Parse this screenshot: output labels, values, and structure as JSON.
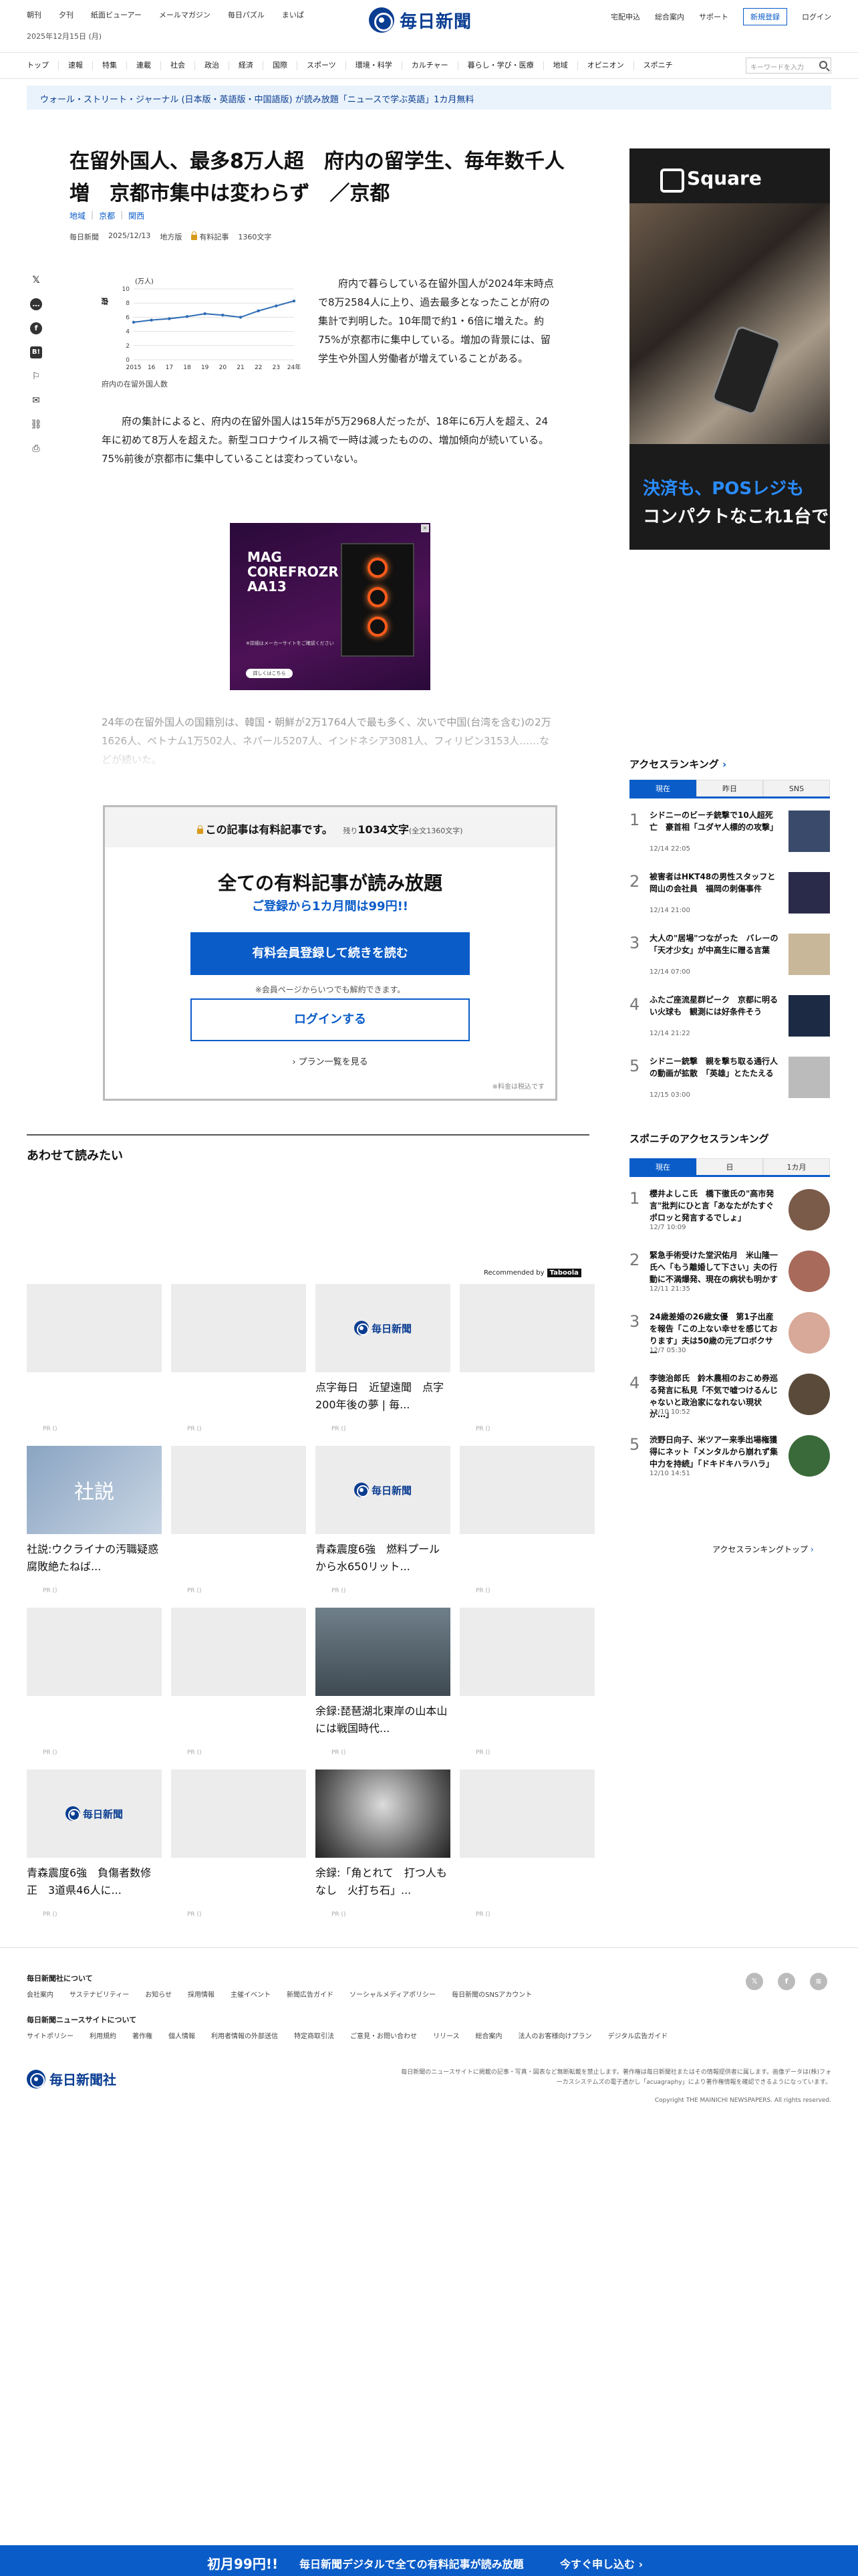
{
  "header": {
    "left_links": [
      "朝刊",
      "夕刊",
      "紙面ビューアー",
      "メールマガジン",
      "毎日パズル",
      "まいぱ"
    ],
    "date": "2025年12月15日 (月)",
    "logo_text": "毎日新聞",
    "right_links": [
      "宅配申込",
      "総合案内",
      "サポート"
    ],
    "signup_label": "新規登録",
    "login_label": "ログイン"
  },
  "nav": {
    "items": [
      "トップ",
      "速報",
      "特集",
      "連載",
      "社会",
      "政治",
      "経済",
      "国際",
      "スポーツ",
      "環境・科学",
      "カルチャー",
      "暮らし・学び・医療",
      "地域",
      "オピニオン",
      "スポニチ"
    ],
    "search_placeholder": "キーワードを入力"
  },
  "promo": "ウォール・ストリート・ジャーナル (日本版・英語版・中国語版) が読み放題「ニュースで学ぶ英語」1カ月無料",
  "article": {
    "headline": "在留外国人、最多8万人超　府内の留学生、毎年数千人増　京都市集中は変わらず　／京都",
    "tags": [
      "地域",
      "京都",
      "関西"
    ],
    "meta": {
      "source": "毎日新聞",
      "date": "2025/12/13",
      "edition": "地方版",
      "paid_label": "有料記事",
      "char_count": "1360文字"
    },
    "para1": "府内で暮らしている在留外国人が2024年末時点で8万2584人に上り、過去最多となったことが府の集計で判明した。10年間で約1・6倍に増えた。約75%が京都市に集中している。増加の背景には、留学生や外国人労働者が増えていることがある。",
    "para2": "府の集計によると、府内の在留外国人は15年が5万2968人だったが、18年に6万人を超え、24年に初めて8万人を超えた。新型コロナウイルス禍で一時は減ったものの、増加傾向が続いている。75%前後が京都市に集中していることは変わっていない。",
    "faded": "24年の在留外国人の国籍別は、韓国・朝鮮が2万1764人で最も多く、次いで中国(台湾を含む)の2万1626人、ベトナム1万502人、ネパール5207人、インドネシア3081人、フィリピン3153人……などが続いた。",
    "chart_caption": "府内の在留外国人数"
  },
  "chart_data": {
    "type": "line",
    "title": "府内の在留外国人数",
    "ylabel": "(万人)",
    "x": [
      "2015",
      "16",
      "17",
      "18",
      "19",
      "20",
      "21",
      "22",
      "23",
      "24年"
    ],
    "values": [
      5.3,
      5.6,
      5.8,
      6.1,
      6.5,
      6.3,
      6.0,
      6.9,
      7.6,
      8.3
    ],
    "yticks": [
      "10",
      "8",
      "6",
      "4",
      "2",
      "0"
    ],
    "ylim": [
      0,
      10
    ],
    "grid": true,
    "color": "#2f6db5"
  },
  "ad_mid": {
    "title": "MAG COREFROZR AA13",
    "note": "※詳細はメーカーサイトをご確認ください",
    "button": "詳しくはこちら"
  },
  "paywall": {
    "head": "この記事は有料記事です。",
    "remaining_prefix": "残り",
    "remaining": "1034文字",
    "remaining_suffix": "(全文1360文字)",
    "title": "全ての有料記事が読み放題",
    "subtitle": "ご登録から1カ月間は99円!!",
    "primary_button": "有料会員登録して続きを読む",
    "note": "※会員ページからいつでも解約できます。",
    "login_button": "ログインする",
    "plans": "プラン一覧を見る",
    "tax": "※料金は税込です"
  },
  "ad_right": {
    "brand": "Square",
    "line1": "決済も、POSレジも",
    "line2": "コンパクトなこれ1台で"
  },
  "ranking": {
    "title": "アクセスランキング",
    "tabs": [
      "現在",
      "昨日",
      "SNS"
    ],
    "items": [
      {
        "num": "1",
        "title": "シドニーのビーチ銃撃で10人超死亡　豪首相「ユダヤ人標的の攻撃」",
        "time": "12/14 22:05"
      },
      {
        "num": "2",
        "title": "被害者はHKT48の男性スタッフと岡山の会社員　福岡の刺傷事件",
        "time": "12/14 21:00"
      },
      {
        "num": "3",
        "title": "大人の\"居場\"つながった　バレーの「天才少女」が中高生に贈る言葉",
        "time": "12/14 07:00"
      },
      {
        "num": "4",
        "title": "ふたご座流星群ピーク　京都に明るい火球も　観測には好条件そう",
        "time": "12/14 21:22"
      },
      {
        "num": "5",
        "title": "シドニー銃撃　親を撃ち取る通行人の動画が拡散　「英雄」とたたえる",
        "time": "12/15 03:00"
      }
    ]
  },
  "sponichi": {
    "title": "スポニチのアクセスランキング",
    "tabs": [
      "現在",
      "日",
      "1カ月"
    ],
    "items": [
      {
        "num": "1",
        "title": "櫻井よしこ氏　橋下徹氏の\"高市発言\"批判にひと言「あなたがたすぐポロッと発言するでしょ」",
        "time": "12/7 10:09"
      },
      {
        "num": "2",
        "title": "緊急手術受けた堂沢佑月　米山隆一氏へ「もう離婚して下さい」夫の行動に不満爆発、現在の病状も明かす",
        "time": "12/11 21:35"
      },
      {
        "num": "3",
        "title": "24歳差婚の26歳女優　第1子出産を報告「この上ない幸せを感じております」夫は50歳の元プロボクサー",
        "time": "12/7 05:30"
      },
      {
        "num": "4",
        "title": "李徳治郎氏　鈴木農相のおこめ券巡る発言に私見「不気で嘘つけるんじゃないと政治家になれない現状が…」",
        "time": "12/10 10:52"
      },
      {
        "num": "5",
        "title": "渋野日向子、米ツアー来季出場権獲得にネット「メンタルから崩れず集中力を持続」「ドキドキハラハラ」",
        "time": "12/10 14:51"
      }
    ],
    "more": "アクセスランキングトップ"
  },
  "related": {
    "title": "あわせて読みたい",
    "recommended_by": "Recommended by",
    "rec_brand": "Taboola",
    "pr": "PR ()",
    "cards": [
      {
        "title": ""
      },
      {
        "title": ""
      },
      {
        "title": "点字毎日　近望遠聞　点字200年後の夢 | 毎..."
      },
      {
        "title": ""
      },
      {
        "title": "社説:ウクライナの汚職疑惑　腐敗絶たねば..."
      },
      {
        "title": ""
      },
      {
        "title": "青森震度6強　燃料プールから水650リット..."
      },
      {
        "title": ""
      },
      {
        "title": ""
      },
      {
        "title": ""
      },
      {
        "title": "余録:琵琶湖北東岸の山本山には戦国時代..."
      },
      {
        "title": ""
      },
      {
        "title": "青森震度6強　負傷者数修正　3道県46人に..."
      },
      {
        "title": ""
      },
      {
        "title": "余録:「角とれて　打つ人もなし　火打ち石」..."
      },
      {
        "title": ""
      }
    ],
    "editorial_text": "社説",
    "logo_text": "毎日新聞"
  },
  "footer": {
    "about_heading": "毎日新聞社について",
    "about_links": [
      "会社案内",
      "サステナビリティー",
      "お知らせ",
      "採用情報",
      "主催イベント",
      "新聞広告ガイド",
      "ソーシャルメディアポリシー",
      "毎日新聞のSNSアカウント"
    ],
    "site_heading": "毎日新聞ニュースサイトについて",
    "site_links": [
      "サイトポリシー",
      "利用規約",
      "著作権",
      "個人情報",
      "利用者情報の外部送信",
      "特定商取引法",
      "ご意見・お問い合わせ",
      "リリース",
      "総合案内",
      "法人のお客様向けプラン",
      "デジタル広告ガイド"
    ],
    "logo_text": "毎日新聞社",
    "note": "毎日新聞のニュースサイトに掲載の記事・写真・図表など無断転載を禁止します。著作権は毎日新聞社またはその情報提供者に属します。画像データは(株)フォーカスシステムズの電子透かし「acuagraphy」により著作権情報を確認できるようになっています。",
    "copyright": "Copyright THE MAINICHI NEWSPAPERS. All rights reserved."
  },
  "bottom_bar": {
    "price": "初月99円!!",
    "message": "毎日新聞デジタルで全ての有料記事が読み放題",
    "cta": "今すぐ申し込む"
  }
}
